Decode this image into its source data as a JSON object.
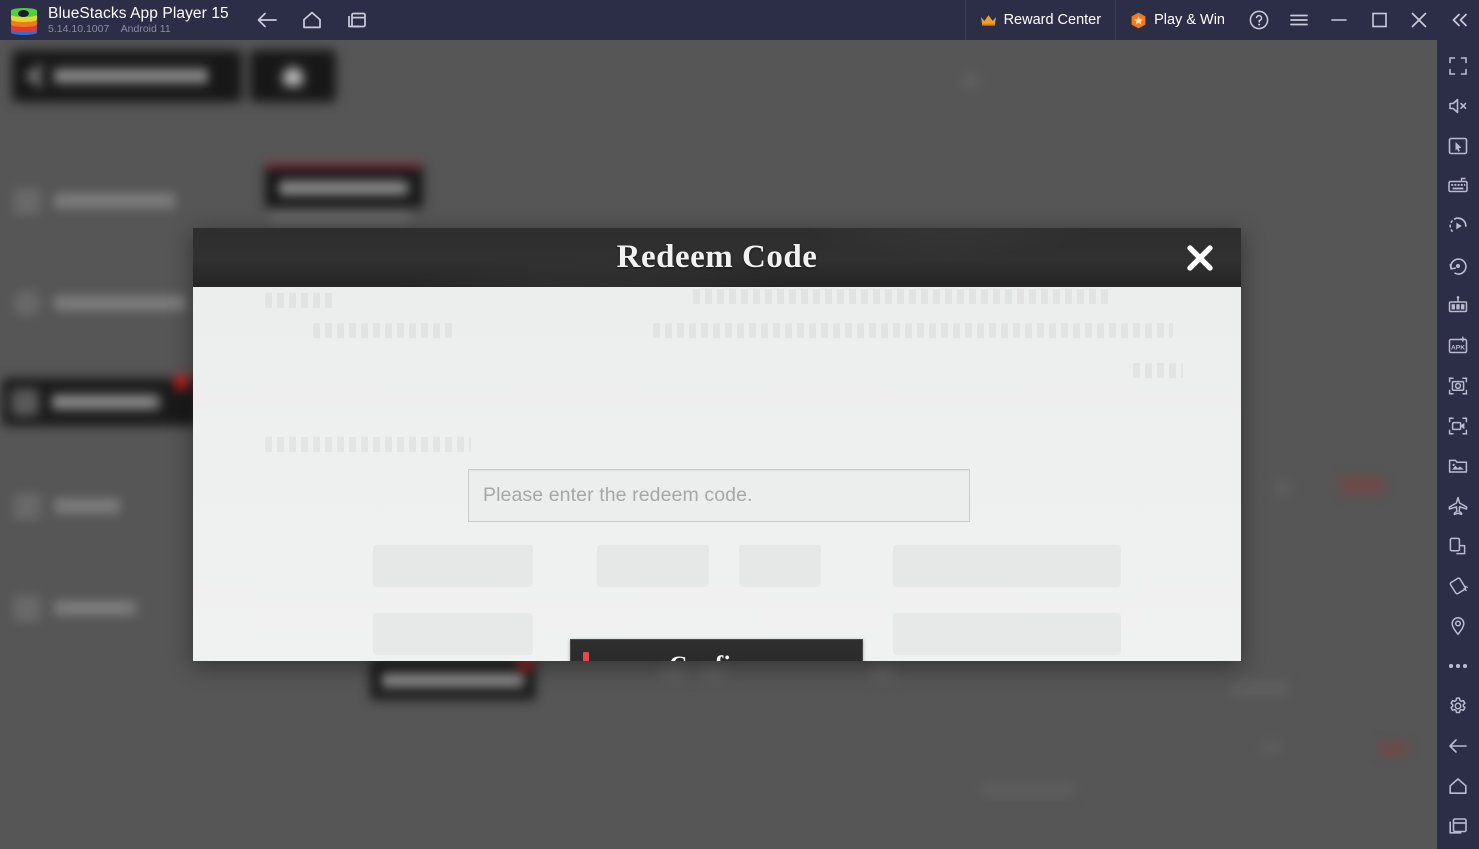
{
  "titlebar": {
    "app_name": "BlueStacks App Player 15",
    "version": "5.14.10.1007",
    "android": "Android 11",
    "logo_icon": "bluestacks-logo",
    "nav": [
      {
        "icon": "back-arrow-icon",
        "label": "Back"
      },
      {
        "icon": "home-icon",
        "label": "Home"
      },
      {
        "icon": "multi-window-icon",
        "label": "Multi-instance"
      }
    ],
    "reward_center": {
      "label": "Reward Center",
      "icon": "crown-icon"
    },
    "play_and_win": {
      "label": "Play & Win",
      "icon": "hex-star-badge-icon"
    },
    "window_controls": [
      {
        "icon": "help-circle-icon",
        "label": "Help"
      },
      {
        "icon": "hamburger-menu-icon",
        "label": "Menu"
      },
      {
        "icon": "minimize-icon",
        "label": "Minimize"
      },
      {
        "icon": "maximize-icon",
        "label": "Maximize"
      },
      {
        "icon": "close-icon",
        "label": "Close"
      },
      {
        "icon": "collapse-chevrons-icon",
        "label": "Collapse sidebar"
      }
    ]
  },
  "sidebar": {
    "items": [
      {
        "icon": "fullscreen-icon",
        "label": "Fullscreen"
      },
      {
        "icon": "mute-speaker-icon",
        "label": "Mute"
      },
      {
        "icon": "cursor-pointer-icon",
        "label": "Game controls"
      },
      {
        "icon": "keyboard-icon",
        "label": "Keymapping"
      },
      {
        "icon": "macro-play-icon",
        "label": "Macro recorder"
      },
      {
        "icon": "rotate-icon",
        "label": "Rotate"
      },
      {
        "icon": "multi-instance-manager-icon",
        "label": "Multi-instance manager"
      },
      {
        "icon": "apk-install-icon",
        "label": "Install APK"
      },
      {
        "icon": "screenshot-camera-icon",
        "label": "Screenshot"
      },
      {
        "icon": "screen-record-icon",
        "label": "Record screen"
      },
      {
        "icon": "media-gallery-icon",
        "label": "Media manager"
      },
      {
        "icon": "airplane-eco-icon",
        "label": "Eco mode"
      },
      {
        "icon": "device-phone-icon",
        "label": "Device profile"
      },
      {
        "icon": "shake-tilt-icon",
        "label": "Shake"
      },
      {
        "icon": "location-pin-icon",
        "label": "Location"
      },
      {
        "icon": "more-dots-icon",
        "label": "More"
      },
      {
        "icon": "settings-gear-icon",
        "label": "Settings"
      },
      {
        "icon": "back-arrow-icon",
        "label": "Back"
      },
      {
        "icon": "home-icon",
        "label": "Home"
      },
      {
        "icon": "recent-apps-icon",
        "label": "Recent apps"
      }
    ]
  },
  "modal": {
    "title": "Redeem Code",
    "close_icon": "close-x-icon",
    "input": {
      "placeholder": "Please enter the redeem code.",
      "value": ""
    },
    "confirm_label": "Confirm",
    "accent_color": "#e14b4b"
  },
  "colors": {
    "titlebar_bg": "#2c2d46",
    "sidebar_bg": "#2c2d46",
    "stage_bg": "#565656",
    "modal_header_bg": "#2e2e2e",
    "modal_body_bg": "#eeefef",
    "confirm_bg": "#2a2a2a",
    "badge_red": "#c41f1f"
  }
}
